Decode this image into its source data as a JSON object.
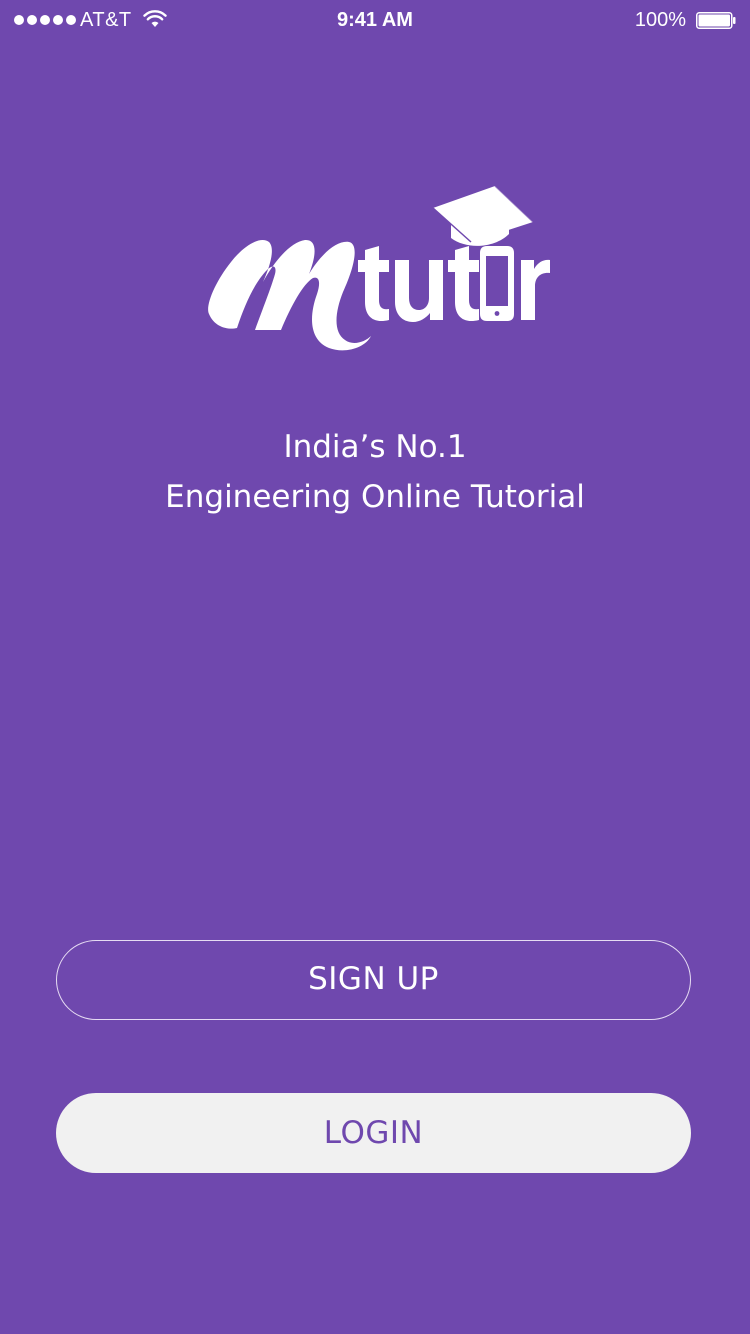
{
  "status_bar": {
    "carrier": "AT&T",
    "time": "9:41 AM",
    "battery_percent": "100%",
    "signal_icon": "signal-dots-icon",
    "wifi_icon": "wifi-icon",
    "battery_icon": "battery-full-icon"
  },
  "brand": {
    "logo_text": "Mtutor",
    "logo_icon": "graduation-cap-phone-icon"
  },
  "tagline": {
    "line1": "India’s No.1",
    "line2": "Engineering Online Tutorial"
  },
  "actions": {
    "signup_label": "SIGN UP",
    "login_label": "LOGIN"
  },
  "colors": {
    "background": "#6f48ae",
    "login_button_bg": "#f1f1f1",
    "login_button_text": "#6f48ae",
    "text": "#ffffff"
  }
}
